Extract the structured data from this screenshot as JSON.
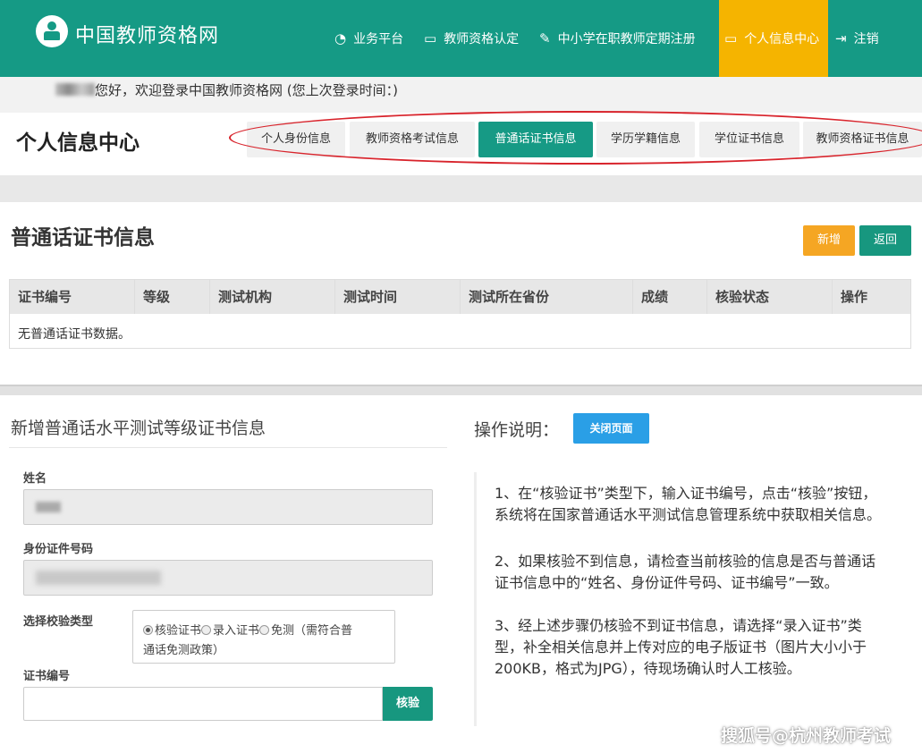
{
  "header": {
    "site_title": "中国教师资格网",
    "nav": [
      {
        "label": "业务平台",
        "icon": "dashboard-icon"
      },
      {
        "label": "教师资格认定",
        "icon": "laptop-icon"
      },
      {
        "label": "中小学在职教师定期注册",
        "icon": "edit-icon"
      },
      {
        "label": "个人信息中心",
        "icon": "laptop-icon",
        "active": true
      },
      {
        "label": "注销",
        "icon": "logout-icon"
      }
    ]
  },
  "welcome": {
    "text": "您好，欢迎登录中国教师资格网 (您上次登录时间：)"
  },
  "page": {
    "title": "个人信息中心",
    "tabs": [
      {
        "label": "个人身份信息"
      },
      {
        "label": "教师资格考试信息"
      },
      {
        "label": "普通话证书信息",
        "active": true
      },
      {
        "label": "学历学籍信息"
      },
      {
        "label": "学位证书信息"
      },
      {
        "label": "教师资格证书信息"
      }
    ]
  },
  "certificates": {
    "title": "普通话证书信息",
    "add_label": "新增",
    "back_label": "返回",
    "columns": [
      "证书编号",
      "等级",
      "测试机构",
      "测试时间",
      "测试所在省份",
      "成绩",
      "核验状态",
      "操作"
    ],
    "empty_text": "无普通话证书数据。"
  },
  "form": {
    "title": "新增普通话水平测试等级证书信息",
    "name_label": "姓名",
    "id_label": "身份证件号码",
    "type_label": "选择校验类型",
    "type_options": {
      "line1": [
        "核验证书",
        "录入证书",
        "免测（需符合普"
      ],
      "line2": "通话免测政策）",
      "selected": "核验证书"
    },
    "cert_label": "证书编号",
    "verify_label": "核验"
  },
  "instructions": {
    "title": "操作说明：",
    "close_label": "关闭页面",
    "p1": "1、在“核验证书”类型下，输入证书编号，点击“核验”按钮，系统将在国家普通话水平测试信息管理系统中获取相关信息。",
    "p2": "2、如果核验不到信息，请检查当前核验的信息是否与普通话证书信息中的“姓名、身份证件号码、证书编号”一致。",
    "p3": "3、经上述步骤仍核验不到证书信息，请选择“录入证书”类型，补全相关信息并上传对应的电子版证书（图片大小小于200KB，格式为JPG），待现场确认时人工核验。"
  },
  "watermark": "搜狐号@杭州教师考试",
  "colors": {
    "primary": "#159a85",
    "active_nav": "#f5b400",
    "add_button": "#f5a623",
    "close_button": "#2a9fe6",
    "annotation": "#d8242c"
  }
}
